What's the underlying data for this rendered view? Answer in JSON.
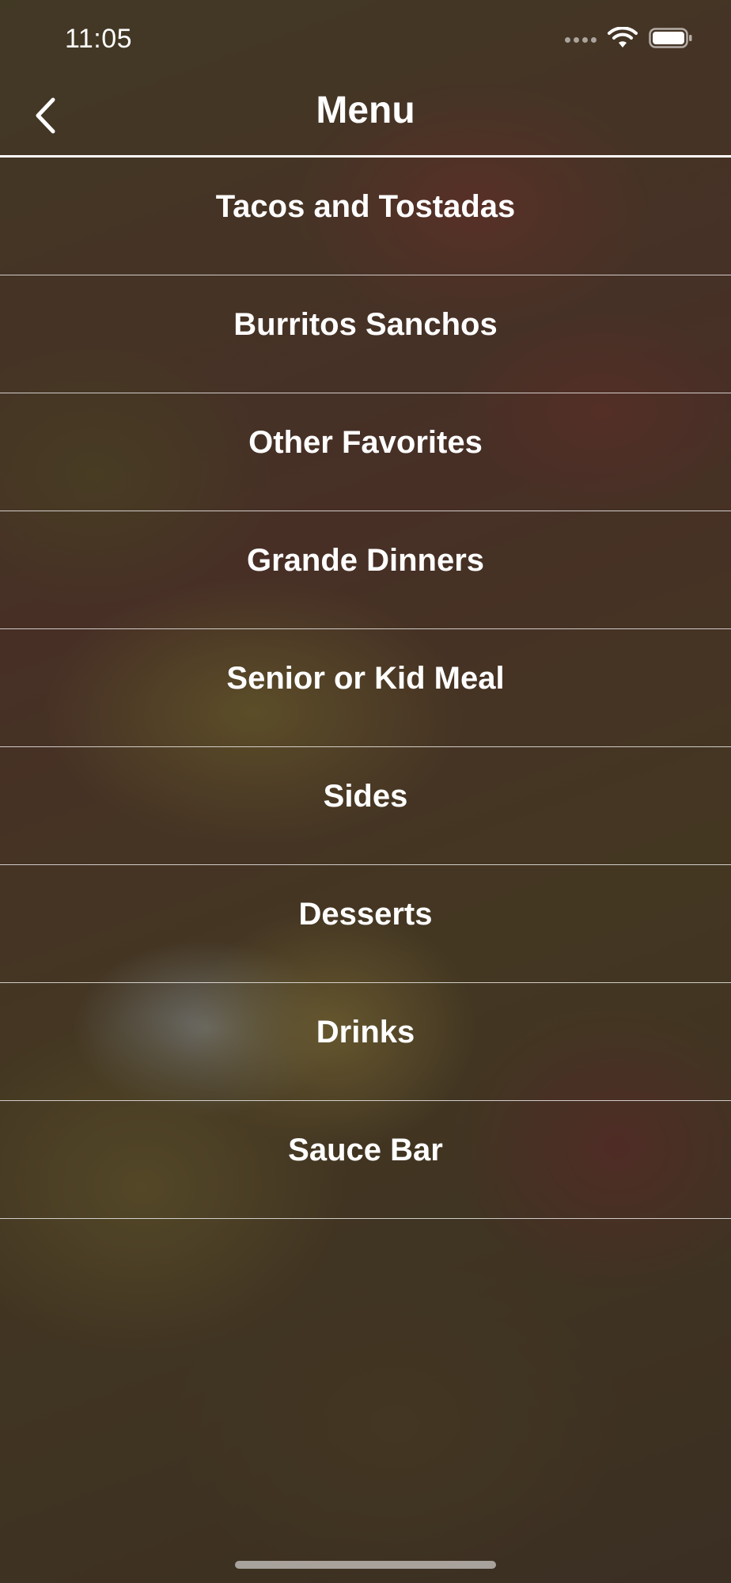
{
  "status_bar": {
    "time": "11:05",
    "icons": [
      "signal-dots-icon",
      "wifi-icon",
      "battery-icon"
    ]
  },
  "nav": {
    "title": "Menu",
    "back_icon": "chevron-left-icon"
  },
  "menu": {
    "items": [
      {
        "label": "Tacos and Tostadas"
      },
      {
        "label": "Burritos Sanchos"
      },
      {
        "label": "Other Favorites"
      },
      {
        "label": "Grande Dinners"
      },
      {
        "label": "Senior or Kid Meal"
      },
      {
        "label": "Sides"
      },
      {
        "label": "Desserts"
      },
      {
        "label": "Drinks"
      },
      {
        "label": "Sauce Bar"
      }
    ]
  },
  "colors": {
    "text": "#ffffff",
    "overlay": "#282828",
    "divider": "#ffffff"
  }
}
